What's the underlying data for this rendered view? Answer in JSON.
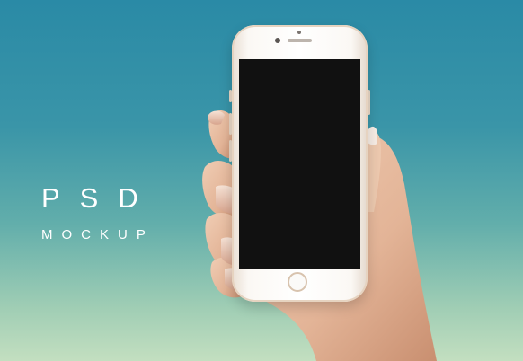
{
  "title": "PSD",
  "subtitle": "MOCKUP",
  "colors": {
    "background_top": "#2a8aa6",
    "background_bottom": "#c3dfc0",
    "text": "#ffffff",
    "phone_body": "#fbf8f4",
    "phone_screen": "#111111",
    "skin": "#e9c1a5"
  }
}
